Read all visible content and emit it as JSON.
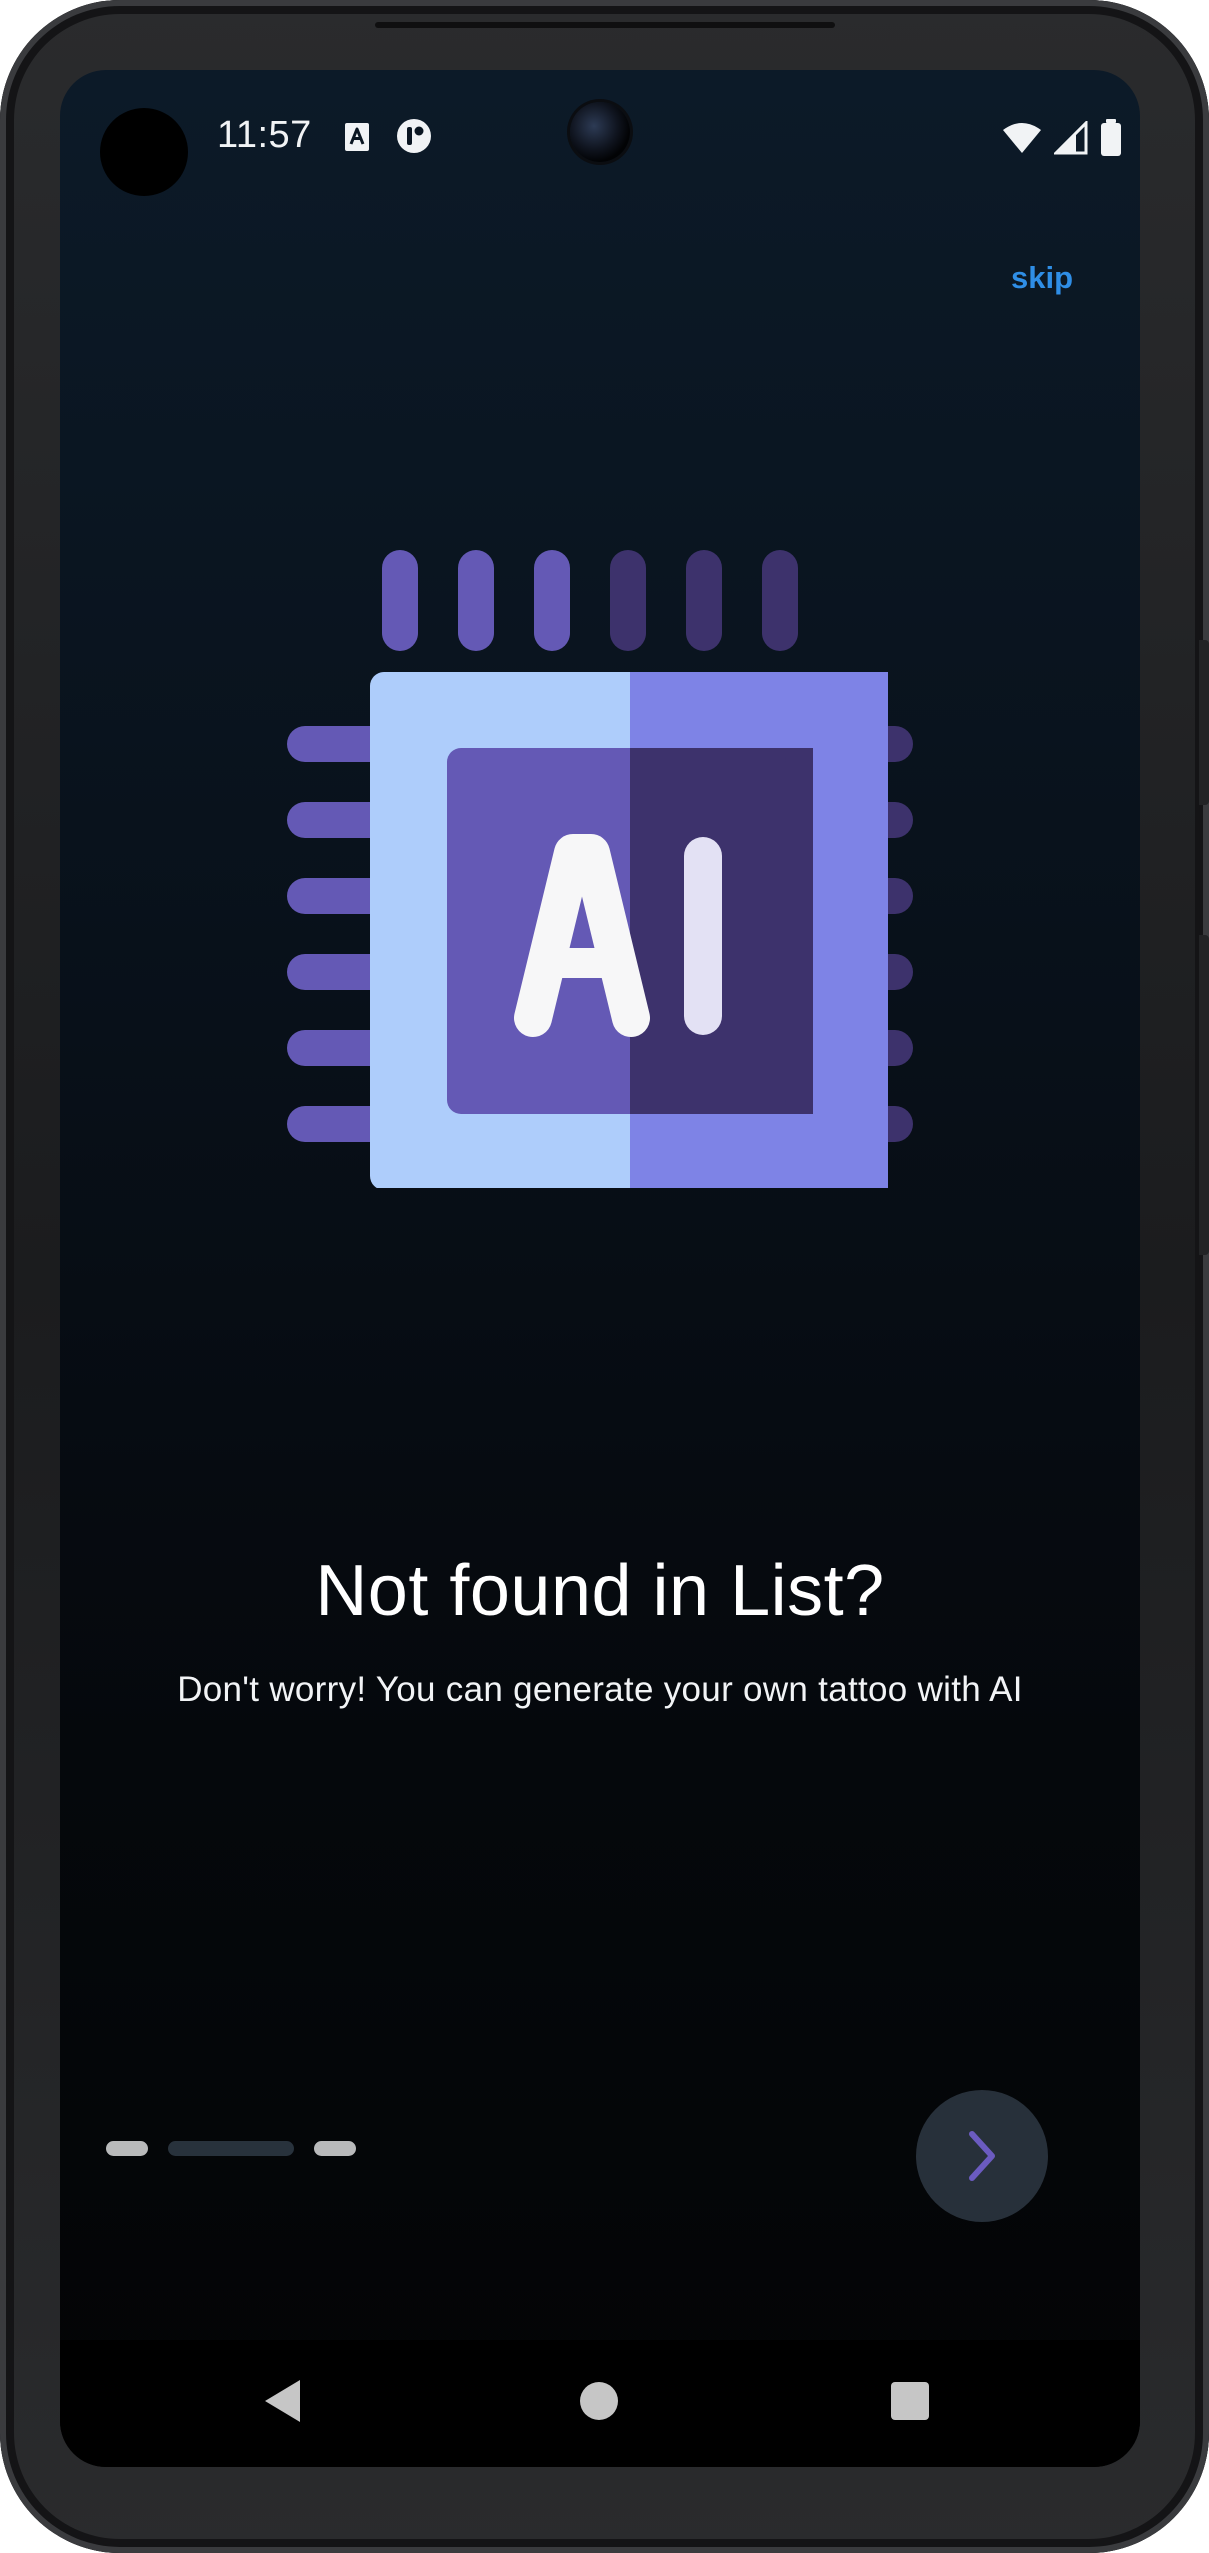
{
  "status_bar": {
    "time": "11:57",
    "icons": [
      "avatar",
      "font-a-icon",
      "podcast-icon",
      "wifi-icon",
      "signal-icon",
      "battery-icon"
    ]
  },
  "onboarding": {
    "skip_label": "skip",
    "illustration": {
      "icon": "ai-chip-icon",
      "text": "AI"
    },
    "title": "Not found in List?",
    "subtitle": "Don't worry! You can generate your own tattoo with AI",
    "page_indicator": {
      "total": 3,
      "current": 2
    },
    "next_button_icon": "chevron-right-icon"
  },
  "navigation_bar": {
    "buttons": [
      "back-icon",
      "home-icon",
      "recents-icon"
    ]
  },
  "colors": {
    "accent": "#2f8ee6",
    "chip_light": "#aecdfb",
    "chip_mid": "#7e83e6",
    "chip_core_left": "#6459b5",
    "chip_core_right": "#3d326c",
    "chevron": "#6b5bc0"
  }
}
